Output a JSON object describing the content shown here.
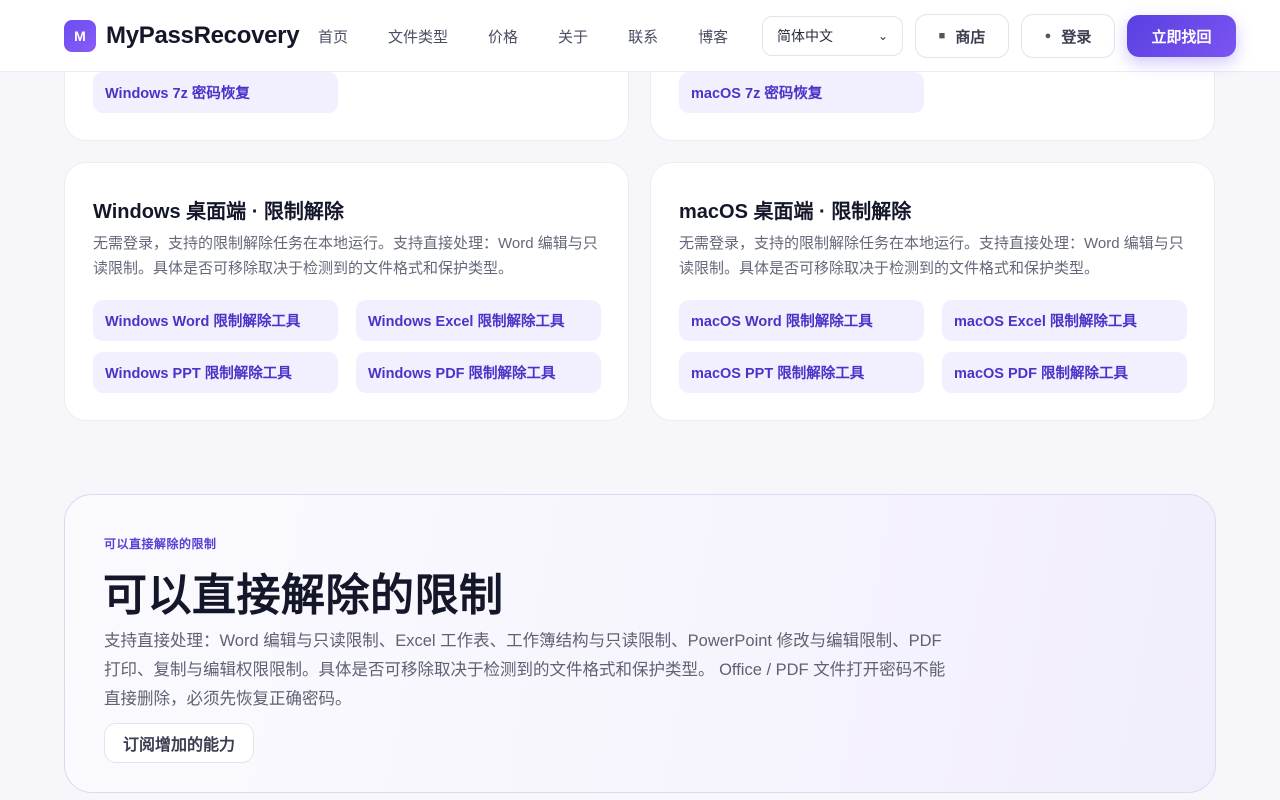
{
  "header": {
    "logo_mark": "M",
    "brand": "MyPassRecovery",
    "nav": [
      "首页",
      "文件类型",
      "价格",
      "关于",
      "联系",
      "博客"
    ],
    "language": "简体中文",
    "shop_label": "商店",
    "login_label": "登录",
    "cta_label": "立即找回"
  },
  "top_cards": {
    "left_link": "Windows 7z 密码恢复",
    "right_link": "macOS 7z 密码恢复"
  },
  "windows_card": {
    "title": "Windows 桌面端 · 限制解除",
    "desc": "无需登录，支持的限制解除任务在本地运行。支持直接处理：Word 编辑与只读限制。具体是否可移除取决于检测到的文件格式和保护类型。",
    "links": [
      "Windows Word 限制解除工具",
      "Windows Excel 限制解除工具",
      "Windows PPT 限制解除工具",
      "Windows PDF 限制解除工具"
    ]
  },
  "mac_card": {
    "title": "macOS 桌面端 · 限制解除",
    "desc": "无需登录，支持的限制解除任务在本地运行。支持直接处理：Word 编辑与只读限制。具体是否可移除取决于检测到的文件格式和保护类型。",
    "links": [
      "macOS Word 限制解除工具",
      "macOS Excel 限制解除工具",
      "macOS PPT 限制解除工具",
      "macOS PDF 限制解除工具"
    ]
  },
  "feature": {
    "eyebrow": "可以直接解除的限制",
    "title": "可以直接解除的限制",
    "body": "支持直接处理：Word 编辑与只读限制、Excel 工作表、工作簿结构与只读限制、PowerPoint 修改与编辑限制、PDF 打印、复制与编辑权限限制。具体是否可移除取决于检测到的文件格式和保护类型。 Office / PDF 文件打开密码不能直接删除，必须先恢复正确密码。",
    "button": "订阅增加的能力"
  },
  "colors": {
    "accent": "#5b3fd6",
    "link_bg": "#f2f0fe",
    "link_text": "#4a33c9"
  }
}
